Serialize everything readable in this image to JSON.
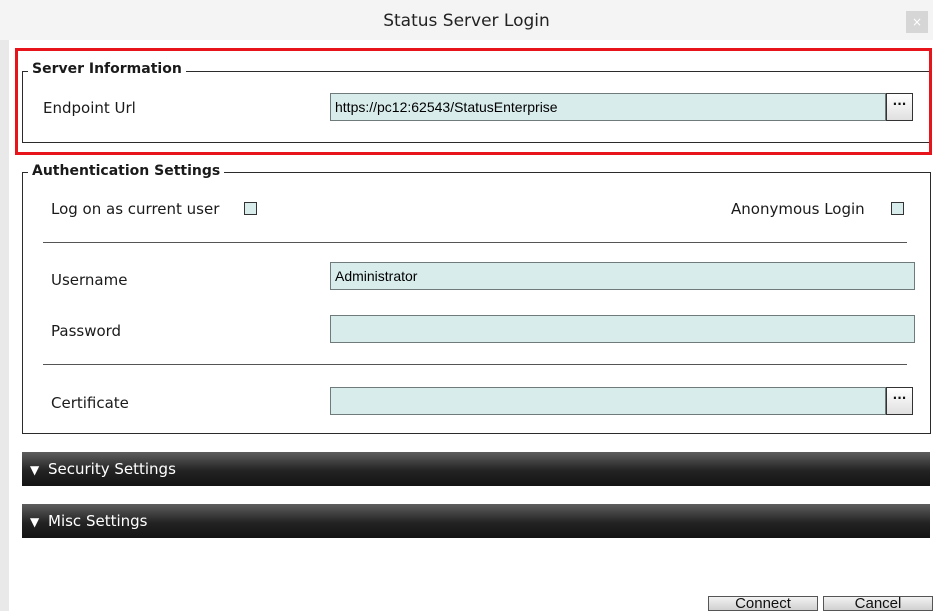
{
  "window": {
    "title": "Status Server Login",
    "close_glyph": "×"
  },
  "server_info": {
    "legend": "Server Information",
    "endpoint_label": "Endpoint Url",
    "endpoint_value": "https://pc12:62543/StatusEnterprise",
    "browse_label": "..."
  },
  "auth": {
    "legend": "Authentication Settings",
    "log_on_current_label": "Log on as current user",
    "log_on_current_checked": false,
    "anonymous_label": "Anonymous Login",
    "anonymous_checked": false,
    "username_label": "Username",
    "username_value": "Administrator",
    "password_label": "Password",
    "password_value": "",
    "certificate_label": "Certificate",
    "certificate_value": "",
    "browse_label": "..."
  },
  "sections": {
    "security_label": "Security Settings",
    "misc_label": "Misc Settings",
    "chevron_icon": "chevron-down-icon"
  },
  "buttons": {
    "connect_label": "Connect",
    "cancel_label": "Cancel"
  },
  "colors": {
    "highlight": "#e8141b",
    "field_bg": "#d9ecec",
    "expander_bg": "#232323"
  }
}
